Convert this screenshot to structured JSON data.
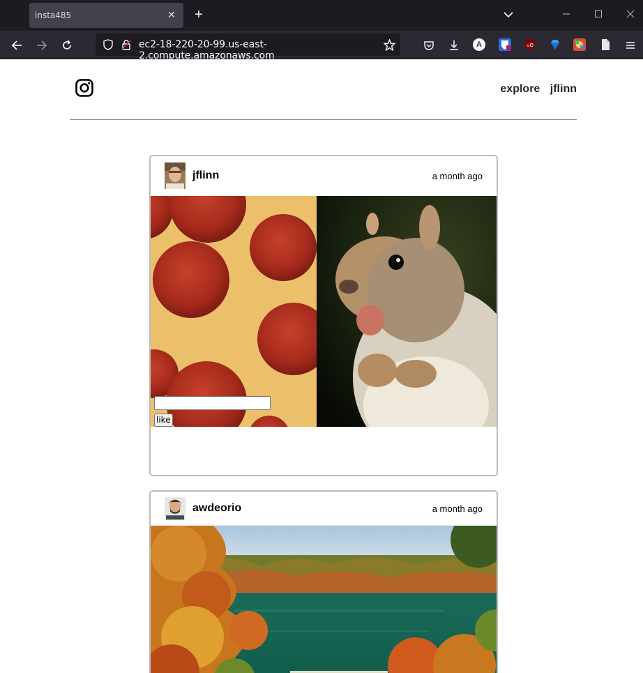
{
  "browser": {
    "tab_title": "insta485",
    "url": "ec2-18-220-20-99.us-east-2.compute.amazonaws.com",
    "ext_badge_letter": "A"
  },
  "site": {
    "nav_explore": "explore",
    "nav_user": "jflinn"
  },
  "posts": [
    {
      "owner": "jflinn",
      "time": "a month ago",
      "like_label": "like",
      "comment_value": ""
    },
    {
      "owner": "awdeorio",
      "time": "a month ago"
    }
  ],
  "colors": {
    "chrome_tabbar": "#1c1b22",
    "chrome_toolbar": "#2b2a33",
    "post_border": "#bdbdbd",
    "header_rule": "#8c8c8c"
  }
}
